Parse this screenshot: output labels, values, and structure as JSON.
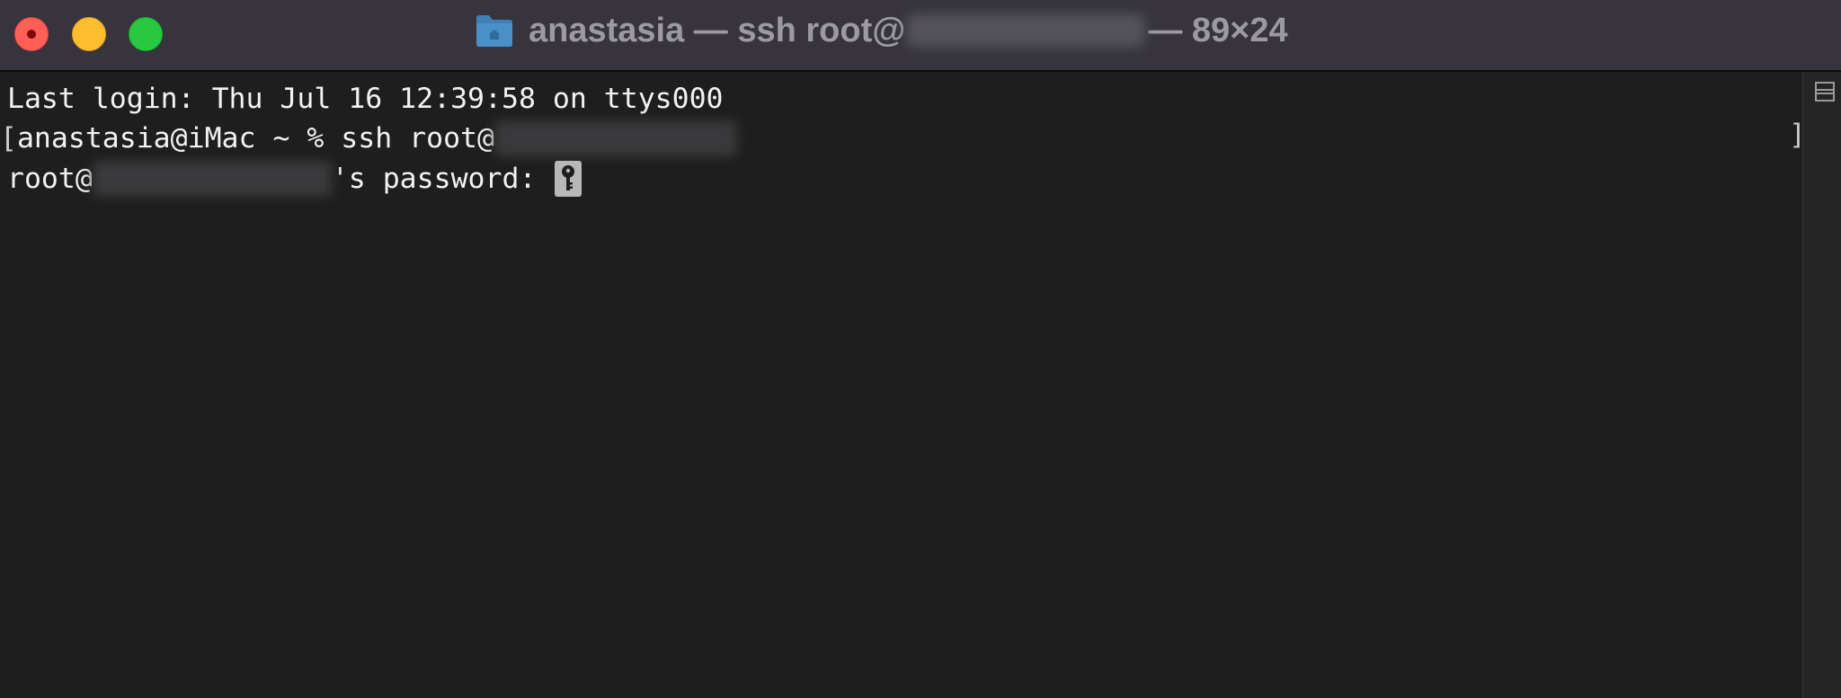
{
  "window": {
    "title_user": "anastasia",
    "title_command": "— ssh root@",
    "title_size": "— 89×24"
  },
  "titlebar": {
    "buttons": [
      {
        "name": "close",
        "color": "#fe5f57"
      },
      {
        "name": "minimize",
        "color": "#febc2e"
      },
      {
        "name": "zoom",
        "color": "#28c840"
      }
    ],
    "folder_icon": "folder-icon"
  },
  "terminal": {
    "line1": "Last login: Thu Jul 16 12:39:58 on ttys000",
    "line2_bracket": "[",
    "line2_prompt": "anastasia@iMac ~ % ssh root@",
    "line2_right_bracket": "]",
    "line3_prefix": "root@",
    "line3_suffix": "'s password: ",
    "cursor_icon": "key-icon"
  },
  "colors": {
    "background": "#1e1e1e",
    "titlebar": "#37343d",
    "text": "#f2f2f2"
  }
}
